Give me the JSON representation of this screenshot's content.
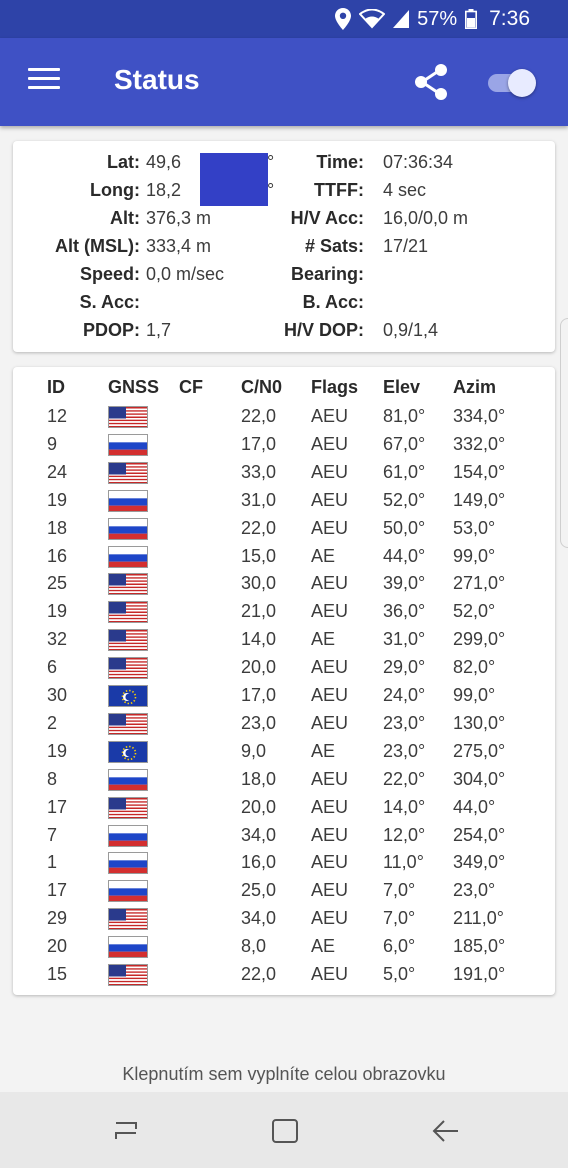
{
  "status_bar": {
    "battery": "57%",
    "time": "7:36"
  },
  "app_bar": {
    "title": "Status"
  },
  "info": {
    "lat_label": "Lat:",
    "lat_value": "49,6",
    "long_label": "Long:",
    "long_value": "18,2",
    "alt_label": "Alt:",
    "alt_value": "376,3 m",
    "alt_msl_label": "Alt (MSL):",
    "alt_msl_value": "333,4 m",
    "speed_label": "Speed:",
    "speed_value": "0,0 m/sec",
    "s_acc_label": "S. Acc:",
    "s_acc_value": "",
    "pdop_label": "PDOP:",
    "pdop_value": "1,7",
    "time_label": "Time:",
    "time_value": "07:36:34",
    "ttff_label": "TTFF:",
    "ttff_value": "4 sec",
    "hv_acc_label": "H/V Acc:",
    "hv_acc_value": "16,0/0,0 m",
    "sats_label": "# Sats:",
    "sats_value": "17/21",
    "bearing_label": "Bearing:",
    "bearing_value": "",
    "b_acc_label": "B. Acc:",
    "b_acc_value": "",
    "hv_dop_label": "H/V DOP:",
    "hv_dop_value": "0,9/1,4",
    "degree_symbol": "°"
  },
  "satellites": {
    "headers": {
      "id": "ID",
      "gnss": "GNSS",
      "cf": "CF",
      "cn0": "C/N0",
      "flags": "Flags",
      "elev": "Elev",
      "azim": "Azim"
    },
    "rows": [
      {
        "id": "12",
        "gnss": "us",
        "cf": "",
        "cn0": "22,0",
        "flags": "AEU",
        "elev": "81,0°",
        "azim": "334,0°"
      },
      {
        "id": "9",
        "gnss": "ru",
        "cf": "",
        "cn0": "17,0",
        "flags": "AEU",
        "elev": "67,0°",
        "azim": "332,0°"
      },
      {
        "id": "24",
        "gnss": "us",
        "cf": "",
        "cn0": "33,0",
        "flags": "AEU",
        "elev": "61,0°",
        "azim": "154,0°"
      },
      {
        "id": "19",
        "gnss": "ru",
        "cf": "",
        "cn0": "31,0",
        "flags": "AEU",
        "elev": "52,0°",
        "azim": "149,0°"
      },
      {
        "id": "18",
        "gnss": "ru",
        "cf": "",
        "cn0": "22,0",
        "flags": "AEU",
        "elev": "50,0°",
        "azim": "53,0°"
      },
      {
        "id": "16",
        "gnss": "ru",
        "cf": "",
        "cn0": "15,0",
        "flags": "AE",
        "elev": "44,0°",
        "azim": "99,0°"
      },
      {
        "id": "25",
        "gnss": "us",
        "cf": "",
        "cn0": "30,0",
        "flags": "AEU",
        "elev": "39,0°",
        "azim": "271,0°"
      },
      {
        "id": "19",
        "gnss": "us",
        "cf": "",
        "cn0": "21,0",
        "flags": "AEU",
        "elev": "36,0°",
        "azim": "52,0°"
      },
      {
        "id": "32",
        "gnss": "us",
        "cf": "",
        "cn0": "14,0",
        "flags": "AE",
        "elev": "31,0°",
        "azim": "299,0°"
      },
      {
        "id": "6",
        "gnss": "us",
        "cf": "",
        "cn0": "20,0",
        "flags": "AEU",
        "elev": "29,0°",
        "azim": "82,0°"
      },
      {
        "id": "30",
        "gnss": "eu",
        "cf": "",
        "cn0": "17,0",
        "flags": "AEU",
        "elev": "24,0°",
        "azim": "99,0°"
      },
      {
        "id": "2",
        "gnss": "us",
        "cf": "",
        "cn0": "23,0",
        "flags": "AEU",
        "elev": "23,0°",
        "azim": "130,0°"
      },
      {
        "id": "19",
        "gnss": "eu",
        "cf": "",
        "cn0": "9,0",
        "flags": "AE",
        "elev": "23,0°",
        "azim": "275,0°"
      },
      {
        "id": "8",
        "gnss": "ru",
        "cf": "",
        "cn0": "18,0",
        "flags": "AEU",
        "elev": "22,0°",
        "azim": "304,0°"
      },
      {
        "id": "17",
        "gnss": "us",
        "cf": "",
        "cn0": "20,0",
        "flags": "AEU",
        "elev": "14,0°",
        "azim": "44,0°"
      },
      {
        "id": "7",
        "gnss": "ru",
        "cf": "",
        "cn0": "34,0",
        "flags": "AEU",
        "elev": "12,0°",
        "azim": "254,0°"
      },
      {
        "id": "1",
        "gnss": "ru",
        "cf": "",
        "cn0": "16,0",
        "flags": "AEU",
        "elev": "11,0°",
        "azim": "349,0°"
      },
      {
        "id": "17",
        "gnss": "ru",
        "cf": "",
        "cn0": "25,0",
        "flags": "AEU",
        "elev": "7,0°",
        "azim": "23,0°"
      },
      {
        "id": "29",
        "gnss": "us",
        "cf": "",
        "cn0": "34,0",
        "flags": "AEU",
        "elev": "7,0°",
        "azim": "211,0°"
      },
      {
        "id": "20",
        "gnss": "ru",
        "cf": "",
        "cn0": "8,0",
        "flags": "AE",
        "elev": "6,0°",
        "azim": "185,0°"
      },
      {
        "id": "15",
        "gnss": "us",
        "cf": "",
        "cn0": "22,0",
        "flags": "AEU",
        "elev": "5,0°",
        "azim": "191,0°"
      }
    ]
  },
  "footer": {
    "hint": "Klepnutím sem vyplníte celou obrazovku"
  },
  "colors": {
    "status_bar": "#2e43a8",
    "app_bar": "#3f51c5",
    "redaction": "#3340c6",
    "background": "#f3f3f3"
  }
}
